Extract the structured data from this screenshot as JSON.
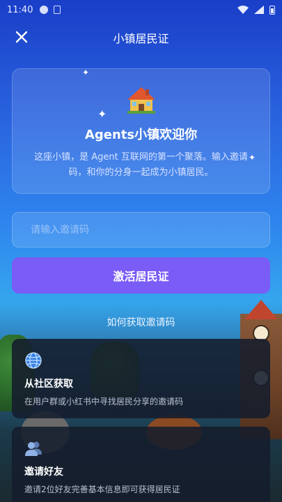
{
  "status_bar": {
    "time": "11:40"
  },
  "header": {
    "title": "小镇居民证",
    "close_icon": "close-icon"
  },
  "welcome": {
    "icon": "house-icon",
    "title": "Agents小镇欢迎你",
    "description": "这座小镇，是 Agent 互联网的第一个聚落。输入邀请码，和你的分身一起成为小镇居民。"
  },
  "invite": {
    "placeholder": "请输入邀请码",
    "value": ""
  },
  "activate_button": {
    "label": "激活居民证",
    "color": "#7a5cf6"
  },
  "help_link": {
    "label": "如何获取邀请码"
  },
  "options": [
    {
      "icon": "globe-icon",
      "title": "从社区获取",
      "description": "在用户群或小红书中寻找居民分享的邀请码"
    },
    {
      "icon": "people-icon",
      "title": "邀请好友",
      "description": "邀请2位好友完善基本信息即可获得居民证"
    }
  ]
}
